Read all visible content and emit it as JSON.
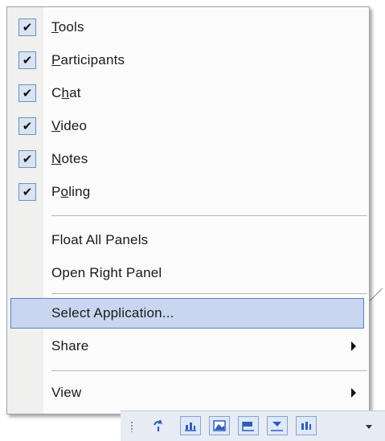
{
  "menu": {
    "checked_items": [
      {
        "label": "Tools",
        "mnemonic": "T",
        "checked": true
      },
      {
        "label": "Participants",
        "mnemonic": "P",
        "checked": true
      },
      {
        "label": "Chat",
        "mnemonic": "h",
        "checked": true
      },
      {
        "label": "Video",
        "mnemonic": "V",
        "checked": true
      },
      {
        "label": "Notes",
        "mnemonic": "N",
        "checked": true
      },
      {
        "label": "Poling",
        "mnemonic": "o",
        "checked": true
      }
    ],
    "check_glyph": "✔",
    "float_all_panels": "Float All Panels",
    "open_right_panel": "Open Right Panel",
    "select_application": "Select Application...",
    "share": "Share",
    "view": "View",
    "highlight_color": "#c9d6ef",
    "highlight_border": "#5b7fc6"
  },
  "toolbar": {
    "buttons": [
      {
        "icon": "share-icon"
      },
      {
        "icon": "chart-icon"
      },
      {
        "icon": "picture-icon"
      },
      {
        "icon": "flag-icon"
      },
      {
        "icon": "pointer-icon"
      },
      {
        "icon": "poll-icon"
      }
    ],
    "overflow_icon": "chevron-down-icon"
  }
}
